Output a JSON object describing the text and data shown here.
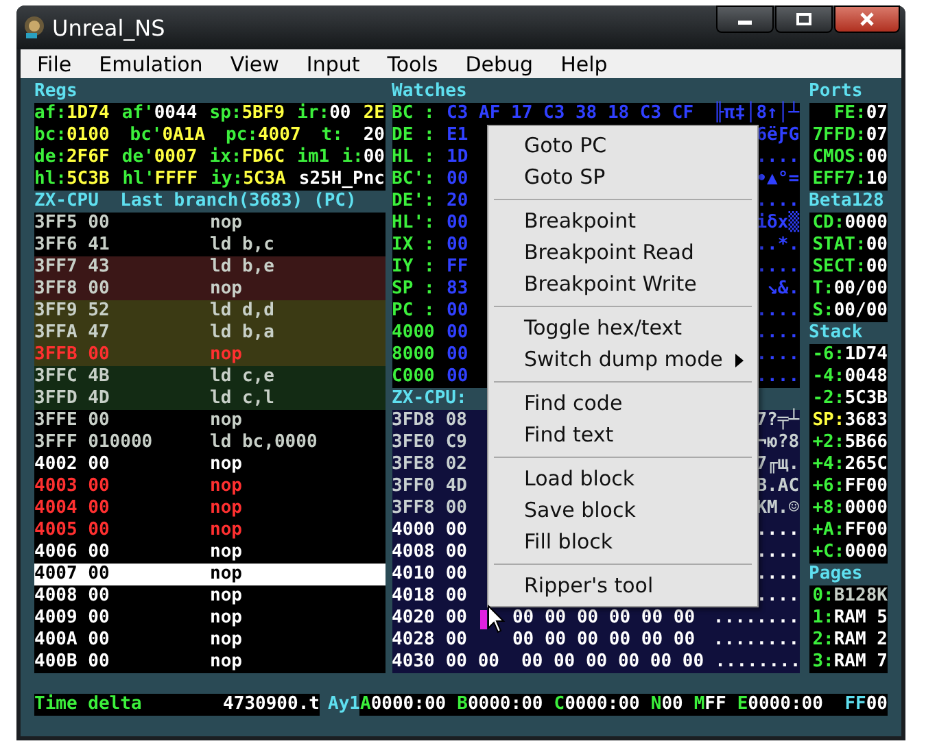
{
  "window": {
    "title": "Unreal_NS"
  },
  "menu": [
    "File",
    "Emulation",
    "View",
    "Input",
    "Tools",
    "Debug",
    "Help"
  ],
  "regs": {
    "title": "Regs",
    "rows": [
      [
        {
          "label": "af:",
          "value": "1D74",
          "changed": true
        },
        {
          "label": "af'",
          "value": "0044",
          "changed": false
        },
        {
          "label": "sp:",
          "value": "5BF9",
          "changed": true
        },
        {
          "label": "ir:",
          "value": "00",
          "changed": false
        },
        {
          "value": "2E",
          "changed": true
        }
      ],
      [
        {
          "label": "bc:",
          "value": "0100",
          "changed": true
        },
        {
          "label": "bc'",
          "value": "0A1A",
          "changed": true
        },
        {
          "label": "pc:",
          "value": "4007",
          "changed": true
        },
        {
          "label": "t:"
        },
        {
          "value": "20",
          "changed": false
        }
      ],
      [
        {
          "label": "de:",
          "value": "2F6F",
          "changed": true
        },
        {
          "label": "de'",
          "value": "0007",
          "changed": true
        },
        {
          "label": "ix:",
          "value": "FD6C",
          "changed": true
        },
        {
          "label": "im1"
        },
        {
          "label": "i:",
          "value": "00",
          "changed": false
        }
      ],
      [
        {
          "label": "hl:",
          "value": "5C3B",
          "changed": true
        },
        {
          "label": "hl'",
          "value": "FFFF",
          "changed": true
        },
        {
          "label": "iy:",
          "value": "5C3A",
          "changed": true
        },
        {
          "value": "s25H_Pnc",
          "changed": false
        }
      ]
    ]
  },
  "disasm": {
    "title": "ZX-CPU  Last branch(3683) (PC)",
    "rows": [
      {
        "addr": "3FF5",
        "bytes": "00",
        "instr": "nop",
        "kind": "old"
      },
      {
        "addr": "3FF6",
        "bytes": "41",
        "instr": "ld b,c",
        "kind": "old"
      },
      {
        "addr": "3FF7",
        "bytes": "43",
        "instr": "ld b,e",
        "kind": "old",
        "color": "#3b1717"
      },
      {
        "addr": "3FF8",
        "bytes": "00",
        "instr": "nop",
        "kind": "old",
        "color": "#3b1717"
      },
      {
        "addr": "3FF9",
        "bytes": "52",
        "instr": "ld d,d",
        "kind": "old",
        "color": "#3b3a14"
      },
      {
        "addr": "3FFA",
        "bytes": "47",
        "instr": "ld b,a",
        "kind": "old",
        "color": "#3b3a14"
      },
      {
        "addr": "3FFB",
        "bytes": "00",
        "instr": "nop",
        "kind": "breakpoint",
        "color": "#3b3a14"
      },
      {
        "addr": "3FFC",
        "bytes": "4B",
        "instr": "ld c,e",
        "kind": "old",
        "color": "#132b14"
      },
      {
        "addr": "3FFD",
        "bytes": "4D",
        "instr": "ld c,l",
        "kind": "old",
        "color": "#132b14"
      },
      {
        "addr": "3FFE",
        "bytes": "00",
        "instr": "nop",
        "kind": "old"
      },
      {
        "addr": "3FFF",
        "bytes": "010000",
        "instr": "ld bc,0000",
        "kind": "old"
      },
      {
        "addr": "4002",
        "bytes": "00",
        "instr": "nop",
        "kind": "normal"
      },
      {
        "addr": "4003",
        "bytes": "00",
        "instr": "nop",
        "kind": "breakpoint"
      },
      {
        "addr": "4004",
        "bytes": "00",
        "instr": "nop",
        "kind": "breakpoint"
      },
      {
        "addr": "4005",
        "bytes": "00",
        "instr": "nop",
        "kind": "breakpoint"
      },
      {
        "addr": "4006",
        "bytes": "00",
        "instr": "nop",
        "kind": "normal"
      },
      {
        "addr": "4007",
        "bytes": "00",
        "instr": "nop",
        "kind": "current"
      },
      {
        "addr": "4008",
        "bytes": "00",
        "instr": "nop",
        "kind": "normal"
      },
      {
        "addr": "4009",
        "bytes": "00",
        "instr": "nop",
        "kind": "normal"
      },
      {
        "addr": "400A",
        "bytes": "00",
        "instr": "nop",
        "kind": "normal"
      },
      {
        "addr": "400B",
        "bytes": "00",
        "instr": "nop",
        "kind": "normal"
      }
    ]
  },
  "watches": {
    "title": "Watches",
    "rows": [
      {
        "label": "BC :",
        "bytes": "C3 AF 17 C3 38 18 C3 CF",
        "text": "╟π‡│8↑│┴"
      },
      {
        "label": "DE :",
        "bytes": "E1",
        "text": "6ëƑG"
      },
      {
        "label": "HL :",
        "bytes": "1D",
        "text": "...."
      },
      {
        "label": "BC':",
        "bytes": "00",
        "text": "•▲°="
      },
      {
        "label": "DE':",
        "bytes": "20",
        "text": "...."
      },
      {
        "label": "HL':",
        "bytes": "00",
        "text": "iδx▒"
      },
      {
        "label": "IX :",
        "bytes": "00",
        "text": "..*."
      },
      {
        "label": "IY :",
        "bytes": "FF",
        "text": "...."
      },
      {
        "label": "SP :",
        "bytes": "83",
        "text": "↘&."
      },
      {
        "label": "PC :",
        "bytes": "00",
        "text": "...."
      },
      {
        "label": "4000",
        "bytes": "00",
        "text": "...."
      },
      {
        "label": "8000",
        "bytes": "00",
        "text": "...."
      },
      {
        "label": "C000",
        "bytes": "00",
        "text": "...."
      }
    ]
  },
  "dump": {
    "title": "ZX-CPU:",
    "rows": [
      {
        "addr": "3FD8",
        "bytes": "08",
        "text": "7?╤┴",
        "kind": "old"
      },
      {
        "addr": "3FE0",
        "bytes": "C9",
        "text": "¬ю?8",
        "kind": "old"
      },
      {
        "addr": "3FE8",
        "bytes": "02",
        "text": "7╓щ.",
        "kind": "old"
      },
      {
        "addr": "3FF0",
        "bytes": "4D",
        "text": "B.AC",
        "kind": "old"
      },
      {
        "addr": "3FF8",
        "bytes": "00",
        "text": "KM.☺",
        "kind": "old"
      },
      {
        "addr": "4000",
        "bytes": "00",
        "text": "....",
        "kind": "new"
      },
      {
        "addr": "4008",
        "bytes": "00",
        "text": "....",
        "kind": "new"
      },
      {
        "addr": "4010",
        "bytes": "00",
        "text": "....",
        "kind": "new"
      },
      {
        "addr": "4018",
        "bytes": "00",
        "text": "....",
        "kind": "new"
      },
      {
        "addr": "4020",
        "bytes": "00",
        "tail": "00 00 00 00 00 00",
        "text": "........",
        "kind": "new"
      },
      {
        "addr": "4028",
        "bytes": "00",
        "tail": "00 00 00 00 00 00",
        "text": "........",
        "kind": "new"
      },
      {
        "addr": "4030",
        "bytes": "00 00",
        "tail": "00 00 00 00 00 00",
        "text": "........",
        "kind": "new"
      }
    ]
  },
  "side": [
    {
      "title": "Ports",
      "rows": [
        {
          "label": "FE:",
          "value": "07"
        },
        {
          "label": "7FFD:",
          "value": "07"
        },
        {
          "label": "CMOS:",
          "value": "00"
        },
        {
          "label": "EFF7:",
          "value": "10"
        }
      ]
    },
    {
      "title": "Beta128",
      "rows": [
        {
          "label": "CD:",
          "value": "0000"
        },
        {
          "label": "STAT:",
          "value": "00"
        },
        {
          "label": "SECT:",
          "value": "00"
        },
        {
          "label": "T:",
          "value": "00/00"
        },
        {
          "label": "S:",
          "value": "00/00"
        }
      ]
    },
    {
      "title": "Stack",
      "rows": [
        {
          "label": "-6:",
          "value": "1D74"
        },
        {
          "label": "-4:",
          "value": "0048"
        },
        {
          "label": "-2:",
          "value": "5C3B"
        },
        {
          "label": "SP:",
          "value": "3683",
          "kind": "sp"
        },
        {
          "label": "+2:",
          "value": "5B66"
        },
        {
          "label": "+4:",
          "value": "265C"
        },
        {
          "label": "+6:",
          "value": "FF00"
        },
        {
          "label": "+8:",
          "value": "0000"
        },
        {
          "label": "+A:",
          "value": "FF00"
        },
        {
          "label": "+C:",
          "value": "0000"
        }
      ]
    },
    {
      "title": "Pages",
      "rows": [
        {
          "label": "0:",
          "value": "B128K",
          "kind": "rom"
        },
        {
          "label": "1:",
          "value": "RAM 5"
        },
        {
          "label": "2:",
          "value": "RAM 2"
        },
        {
          "label": "3:",
          "value": "RAM 7"
        }
      ]
    }
  ],
  "status": {
    "label": "Time delta",
    "value": "4730900.t",
    "chip": "Ay1",
    "regs": [
      {
        "key": "A",
        "value": "0000:00"
      },
      {
        "key": "B",
        "value": "0000:00"
      },
      {
        "key": "C",
        "value": "0000:00"
      },
      {
        "key": "N",
        "value": "00"
      },
      {
        "key": "M",
        "value": "FF"
      },
      {
        "key": "E",
        "value": "0000:00"
      }
    ],
    "env": {
      "key": "FF",
      "value": "00"
    }
  },
  "context_menu": [
    {
      "kind": "item",
      "label": "Goto PC"
    },
    {
      "kind": "item",
      "label": "Goto SP"
    },
    {
      "kind": "separator"
    },
    {
      "kind": "item",
      "label": "Breakpoint"
    },
    {
      "kind": "item",
      "label": "Breakpoint Read"
    },
    {
      "kind": "item",
      "label": "Breakpoint Write"
    },
    {
      "kind": "separator"
    },
    {
      "kind": "item",
      "label": "Toggle hex/text"
    },
    {
      "kind": "submenu",
      "label": "Switch dump mode"
    },
    {
      "kind": "separator"
    },
    {
      "kind": "item",
      "label": "Find code"
    },
    {
      "kind": "item",
      "label": "Find text"
    },
    {
      "kind": "separator"
    },
    {
      "kind": "item",
      "label": "Load block"
    },
    {
      "kind": "item",
      "label": "Save block"
    },
    {
      "kind": "item",
      "label": "Fill block"
    },
    {
      "kind": "separator"
    },
    {
      "kind": "item",
      "label": "Ripper's tool"
    }
  ]
}
